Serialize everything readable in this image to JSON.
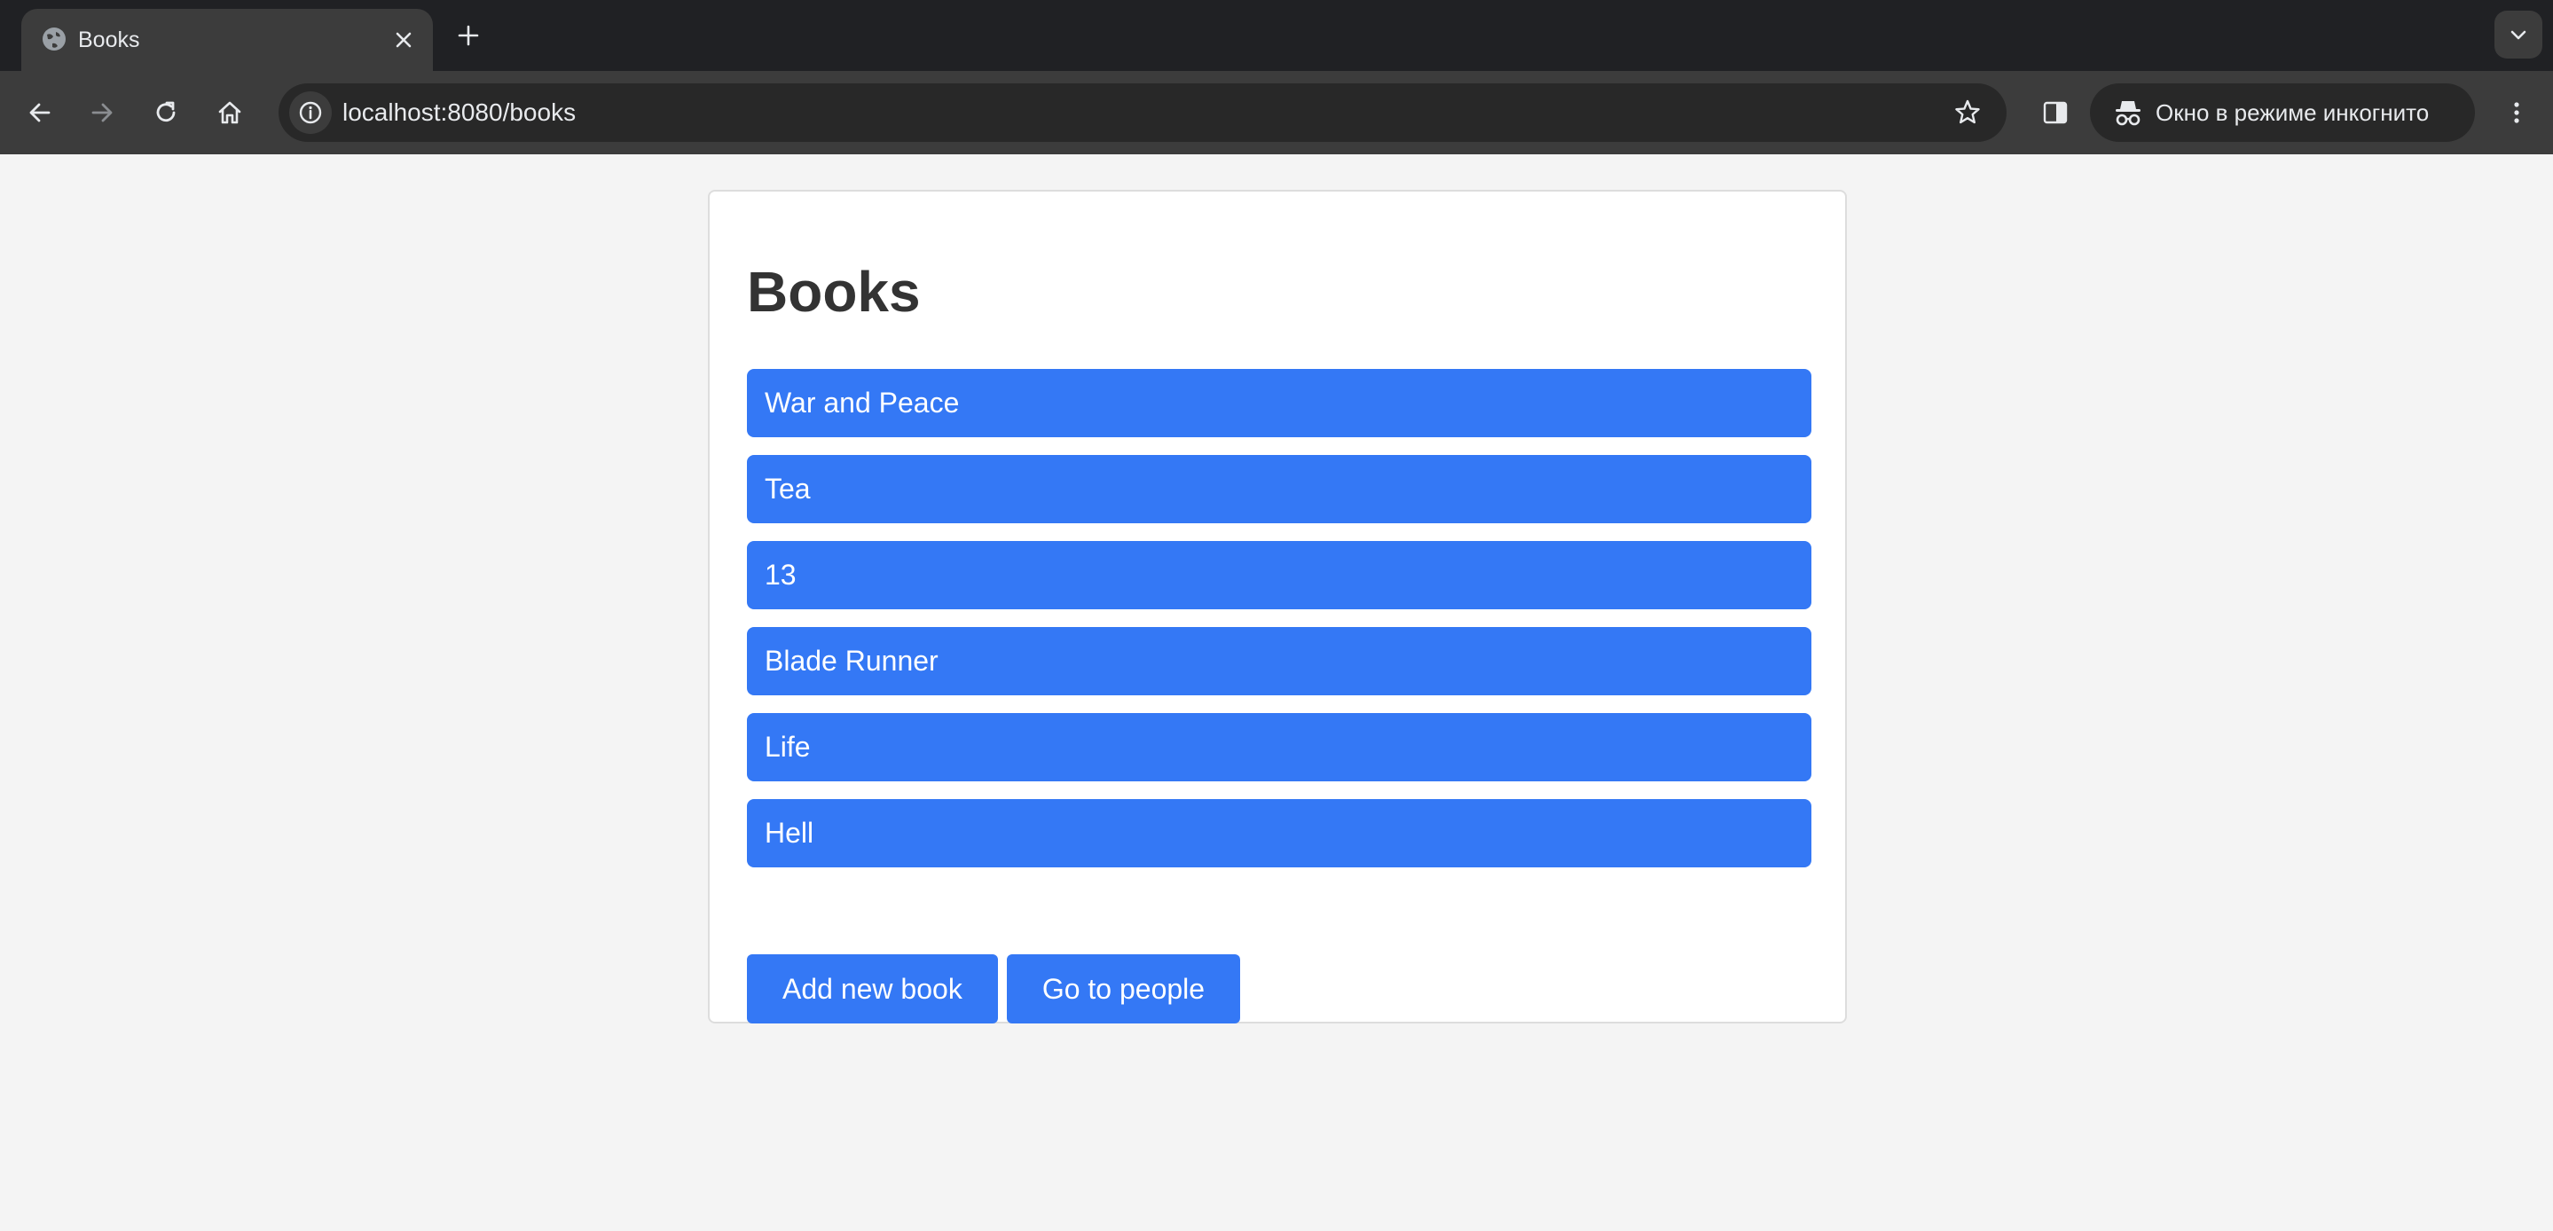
{
  "browser": {
    "tab": {
      "title": "Books",
      "favicon": "globe-icon"
    },
    "address_bar": {
      "url": "localhost:8080/books"
    },
    "incognito_label": "Окно в режиме инкогнито",
    "icons": {
      "back": "arrow-left-icon",
      "forward": "arrow-right-icon",
      "reload": "reload-icon",
      "home": "home-icon",
      "site_info": "info-icon",
      "bookmark": "star-icon",
      "side_panel": "side-panel-icon",
      "menu": "kebab-menu-icon"
    }
  },
  "page": {
    "title": "Books",
    "books": [
      {
        "title": "War and Peace"
      },
      {
        "title": "Tea"
      },
      {
        "title": "13"
      },
      {
        "title": "Blade Runner"
      },
      {
        "title": "Life"
      },
      {
        "title": "Hell"
      }
    ],
    "actions": {
      "add_label": "Add new book",
      "people_label": "Go to people"
    }
  },
  "colors": {
    "accent": "#3478f5",
    "page_background": "#f4f4f4",
    "card_background": "#ffffff",
    "title_text": "#333333"
  }
}
